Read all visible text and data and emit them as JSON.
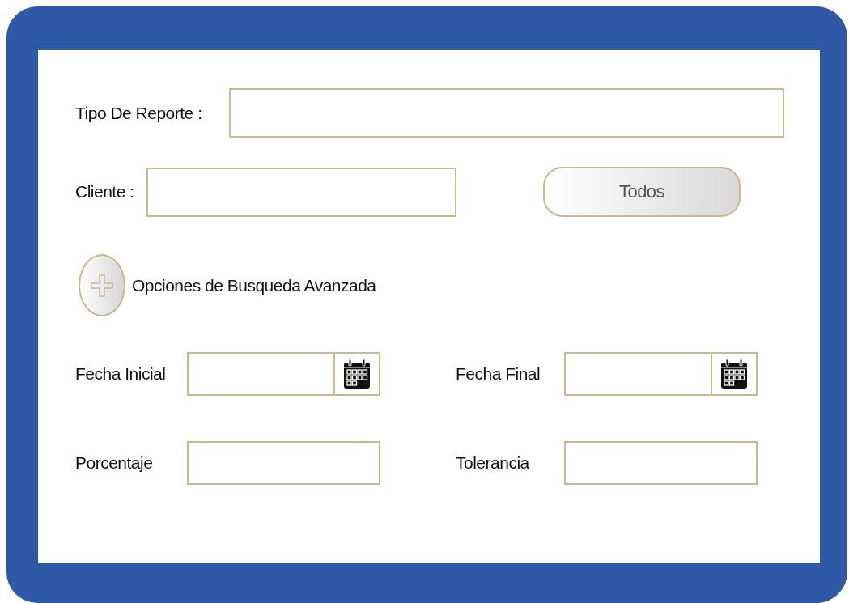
{
  "report_type": {
    "label": "Tipo De Reporte :"
  },
  "client": {
    "label": "Cliente :"
  },
  "all_button": {
    "label": "Todos"
  },
  "advanced_search": {
    "label": "Opciones de Busqueda Avanzada",
    "expanded": false
  },
  "fields": [
    {
      "label": "Fecha Inicial",
      "kind": "date"
    },
    {
      "label": "Fecha Final",
      "kind": "date"
    },
    {
      "label": "Porcentaje",
      "kind": "text"
    },
    {
      "label": "Tolerancia",
      "kind": "text"
    }
  ]
}
